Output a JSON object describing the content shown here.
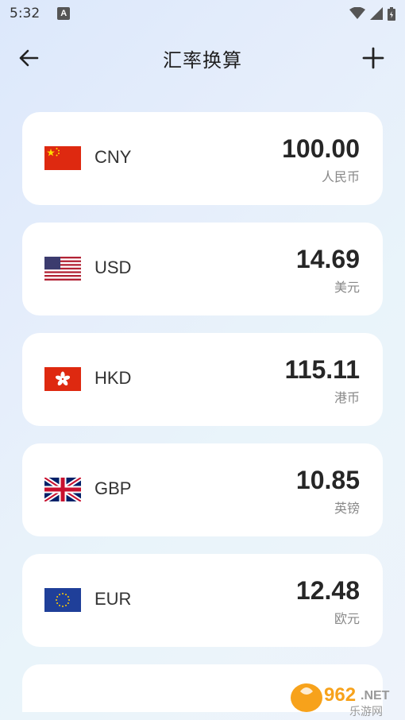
{
  "status": {
    "time": "5:32",
    "badge": "A"
  },
  "header": {
    "title": "汇率换算"
  },
  "currencies": [
    {
      "code": "CNY",
      "amount": "100.00",
      "name": "人民币",
      "flag": "china-flag"
    },
    {
      "code": "USD",
      "amount": "14.69",
      "name": "美元",
      "flag": "us-flag"
    },
    {
      "code": "HKD",
      "amount": "115.11",
      "name": "港币",
      "flag": "hong-kong-flag"
    },
    {
      "code": "GBP",
      "amount": "10.85",
      "name": "英镑",
      "flag": "uk-flag"
    },
    {
      "code": "EUR",
      "amount": "12.48",
      "name": "欧元",
      "flag": "eu-flag"
    }
  ],
  "watermark": {
    "brand": "962.NET",
    "sub": "乐游网"
  },
  "colors": {
    "accent": "#f7a21b",
    "text": "#262626",
    "muted": "#888888"
  }
}
